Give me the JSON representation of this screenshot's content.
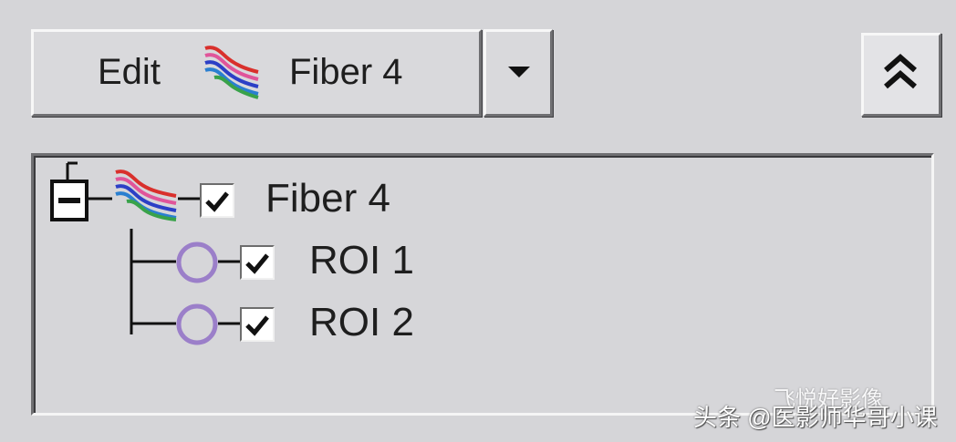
{
  "toolbar": {
    "edit_label": "Edit",
    "fiber_name": "Fiber 4"
  },
  "icons": {
    "fiber": "fiber-bundle-icon",
    "roi": "roi-circle-icon",
    "dropdown": "chevron-down-icon",
    "collapse": "double-chevron-up-icon",
    "tree_toggle": "collapse-minus-icon"
  },
  "tree": {
    "root": {
      "label": "Fiber 4",
      "checked": true,
      "expanded": true
    },
    "children": [
      {
        "label": "ROI 1",
        "checked": true
      },
      {
        "label": "ROI 2",
        "checked": true
      }
    ]
  },
  "colors": {
    "roi_circle": "#9b7fc9",
    "fiber_red": "#d9302c",
    "fiber_blue": "#2c3fc6",
    "fiber_green": "#39a24a"
  },
  "watermark": {
    "text": "头条 @医影师华哥小课",
    "logo_text": "飞悦好影像"
  }
}
